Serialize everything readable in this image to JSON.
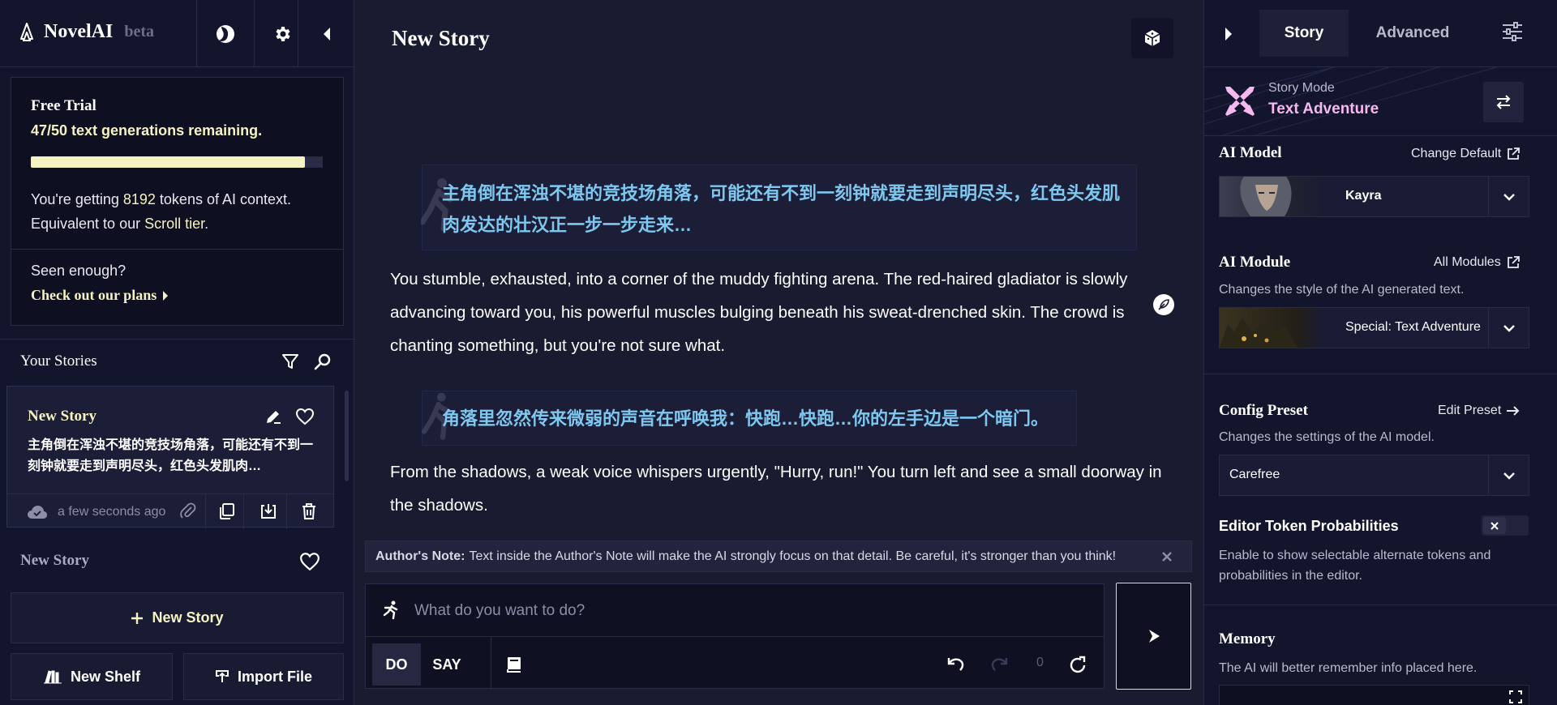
{
  "app": {
    "name": "NovelAI",
    "badge": "beta"
  },
  "trial": {
    "title": "Free Trial",
    "remaining": "47/50 text generations remaining.",
    "progress": 0.94,
    "context_prefix": "You're getting ",
    "context_tokens": "8192",
    "context_mid": " tokens of AI context.",
    "equiv_prefix": "Equivalent to our ",
    "tier": "Scroll tier",
    "equiv_suffix": ".",
    "seen": "Seen enough?",
    "plans_link": "Check out our plans"
  },
  "stories": {
    "header": "Your Stories",
    "items": [
      {
        "title": "New Story",
        "preview": "主角倒在浑浊不堪的竞技场角落，可能还有不到一刻钟就要走到声明尽头，红色头发肌肉…",
        "saved": "a few seconds ago"
      },
      {
        "title": "New Story"
      }
    ],
    "new_story": "New Story",
    "new_shelf": "New Shelf",
    "import_file": "Import File"
  },
  "editor": {
    "title": "New Story",
    "action1": "主角倒在浑浊不堪的竞技场角落，可能还有不到一刻钟就要走到声明尽头，红色头发肌肉发达的壮汉正一步一步走来…",
    "para1": "You stumble, exhausted, into a corner of the muddy fighting arena. The red-haired gladiator is slowly advancing toward you, his powerful muscles bulging beneath his sweat-drenched skin. The crowd is chanting something, but you're not sure what.",
    "action2": "角落里忽然传来微弱的声音在呼唤我：快跑…快跑…你的左手边是一个暗门。",
    "para2": "From the shadows, a weak voice whispers urgently, \"Hurry, run!\" You turn left and see a small doorway in the shadows.",
    "authors_note_label": "Author's Note:",
    "authors_note_text": "Text inside the Author's Note will make the AI strongly focus on that detail. Be careful, it's stronger than you think!",
    "input_placeholder": "What do you want to do?",
    "mode_do": "DO",
    "mode_say": "SAY",
    "redo_count": "0"
  },
  "settings": {
    "tabs": [
      "Story",
      "Advanced"
    ],
    "story_mode_label": "Story Mode",
    "story_mode_value": "Text Adventure",
    "ai_model_title": "AI Model",
    "ai_model_link": "Change Default",
    "ai_model_value": "Kayra",
    "ai_module_title": "AI Module",
    "ai_module_link": "All Modules",
    "ai_module_desc": "Changes the style of the AI generated text.",
    "ai_module_value": "Special: Text Adventure",
    "preset_title": "Config Preset",
    "preset_link": "Edit Preset",
    "preset_desc": "Changes the settings of the AI model.",
    "preset_value": "Carefree",
    "token_prob_title": "Editor Token Probabilities",
    "token_prob_desc": "Enable to show selectable alternate tokens and probabilities in the editor.",
    "memory_title": "Memory",
    "memory_desc": "The AI will better remember info placed here."
  },
  "colors": {
    "accent": "#f5f3c2",
    "action": "#7ec8f0",
    "mode": "#f5b8ef",
    "bg": "#191b31",
    "panel": "#13152c"
  }
}
